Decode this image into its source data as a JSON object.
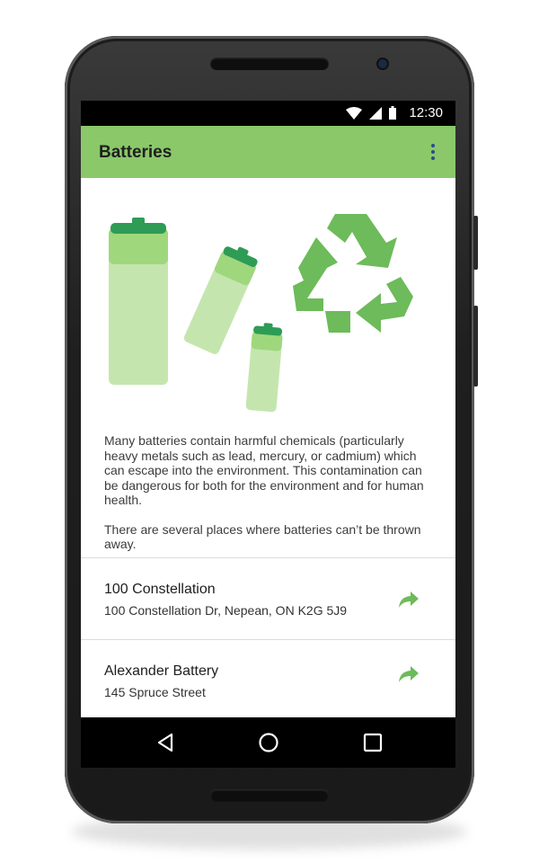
{
  "status_bar": {
    "time": "12:30"
  },
  "app_bar": {
    "title": "Batteries",
    "menu_icon": "more-vert-icon"
  },
  "colors": {
    "app_bar": "#8bc86a",
    "accent_green": "#6dbb5a",
    "battery_light": "#bfe3a8",
    "battery_cap": "#2e9c55"
  },
  "description": {
    "paragraph1": "Many batteries contain harmful chemicals (particularly heavy metals such as lead, mercury, or cadmium) which can escape into the environment. This contamination can be dangerous for both for the environment and for human health.",
    "paragraph2": "There are several places where batteries can’t be thrown away."
  },
  "locations": [
    {
      "name": "100 Constellation",
      "address": "100 Constellation Dr, Nepean, ON K2G 5J9",
      "action_icon": "directions-arrow-icon"
    },
    {
      "name": "Alexander Battery",
      "address": "145 Spruce Street",
      "action_icon": "directions-arrow-icon"
    }
  ],
  "nav_bar": {
    "back": "back-icon",
    "home": "home-icon",
    "recents": "recents-icon"
  }
}
